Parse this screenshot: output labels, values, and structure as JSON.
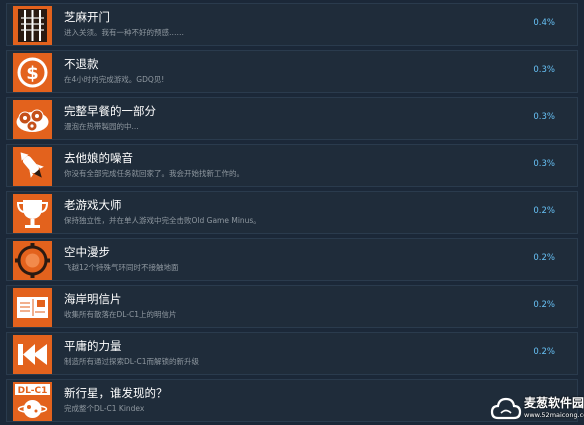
{
  "achievements": [
    {
      "icon": "skeleton-cage-icon",
      "title": "芝麻开门",
      "desc": "进入关须。我有一种不好的预感……",
      "pct": "0.4%"
    },
    {
      "icon": "dollar-coin-icon",
      "title": "不退款",
      "desc": "在4小时内完成游戏。GDQ见!",
      "pct": "0.3%"
    },
    {
      "icon": "donuts-plate-icon",
      "title": "完整早餐的一部分",
      "desc": "漫泡在热带製园的中...",
      "pct": "0.3%"
    },
    {
      "icon": "rocket-icon",
      "title": "去他娘的噪音",
      "desc": "你没有全部完成任务就回家了。我会开始找新工作的。",
      "pct": "0.3%"
    },
    {
      "icon": "trophy-icon",
      "title": "老游戏大师",
      "desc": "保持独立性，并在单人游戏中完全击败Old Game Minus。",
      "pct": "0.2%"
    },
    {
      "icon": "gear-ring-icon",
      "title": "空中漫步",
      "desc": "飞越12个特殊气环同时不接触地面",
      "pct": "0.2%"
    },
    {
      "icon": "postcard-icon",
      "title": "海岸明信片",
      "desc": "收集所有散落在DL-C1上的明信片",
      "pct": "0.2%"
    },
    {
      "icon": "rewind-icon",
      "title": "平庸的力量",
      "desc": "制造所有通过探索DL-C1而解锁的新升级",
      "pct": "0.2%"
    },
    {
      "icon": "dl-c1-planet-icon",
      "title": "新行星，谁发现的？",
      "desc": "完成整个DL-C1 Kindex",
      "pct": ""
    }
  ],
  "icon_badge_text": "DL-C1",
  "watermark": {
    "text": "麦葱软件园",
    "url": "www.52maicong.com"
  }
}
